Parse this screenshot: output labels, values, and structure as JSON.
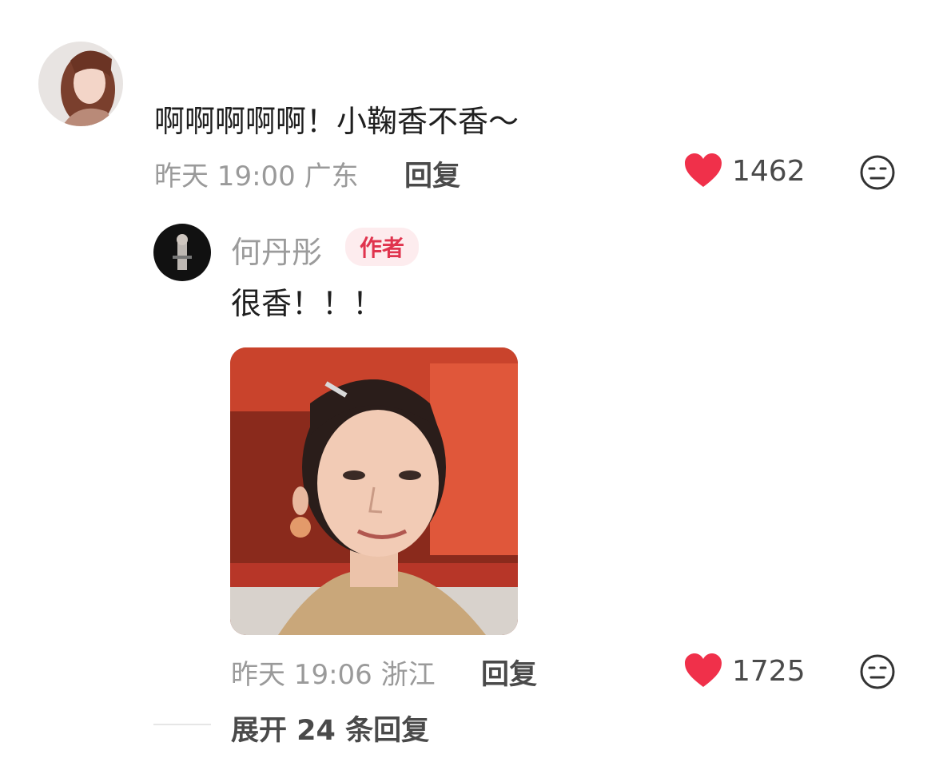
{
  "comment": {
    "text": "啊啊啊啊啊！小鞠香不香～",
    "meta": "昨天 19:00 广东",
    "reply_label": "回复",
    "likes": "1462",
    "like_icon": "heart-icon",
    "dislike_icon": "neutral-face-icon"
  },
  "reply": {
    "username": "何丹彤",
    "badge": "作者",
    "text": "很香！！！",
    "meta": "昨天 19:06 浙江",
    "reply_label": "回复",
    "likes": "1725",
    "like_icon": "heart-icon",
    "dislike_icon": "neutral-face-icon"
  },
  "expand_label": "展开 24 条回复",
  "colors": {
    "heart": "#f0304a",
    "badge_bg": "#fdecee",
    "badge_text": "#e0344e",
    "meta_text": "#9a9a9a"
  }
}
